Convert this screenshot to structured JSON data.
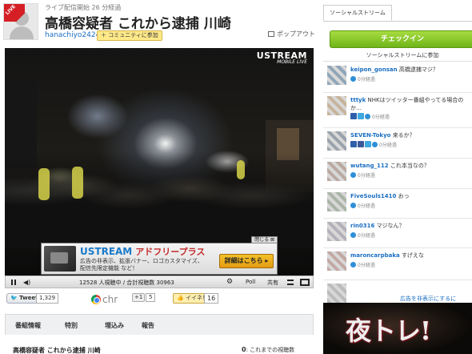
{
  "header": {
    "live_badge": "LIVE",
    "status_line": "ライブ配信開始 26 分経過",
    "title": "高橋容疑者 これから逮捕 川崎",
    "channel": "hanachiyo2424",
    "community_button": "＋ コミュニティに参加",
    "popout": "ポップアウト"
  },
  "player": {
    "logo_main": "USTREAM",
    "logo_sub": "MOBILE LIVE",
    "ad": {
      "close": "閉じる ⊠",
      "title": "USTREAM",
      "title_sub": "アドフリープラス",
      "text": "広告の非表示、拡張バナー、ロゴカスタマイズ、配信先限定機能 など！",
      "button": "詳細はこちら ▸"
    },
    "controls": {
      "volume_icon": "volume-icon",
      "viewers": "12528 人視聴中 / 合計視聴数 30963",
      "gear": "⚙",
      "poll": "Poll",
      "share": "共有"
    }
  },
  "share_row": {
    "tweet": "🐦 Tweet",
    "tweet_count": "1,329",
    "chrome_text": "chr",
    "gplus": "+1",
    "gplus_count": "5",
    "iine": "👍 イイネ！",
    "iine_count": "16"
  },
  "tabs": [
    "番組情報",
    "特別",
    "埋込み",
    "報告"
  ],
  "info": {
    "title": "高橋容疑者 これから逮捕 川崎",
    "views_count": "0",
    "views_label": ": これまでの視聴数"
  },
  "sidebar": {
    "tab_label": "ソーシャルストリーム",
    "checkin": "チェックイン",
    "join": "ソーシャルストリームに参加",
    "posts": [
      {
        "user": "keipon_gonsan",
        "text": "高橋逮捕マジ？",
        "time": "0分経過",
        "services": [],
        "color": "#8fa6b8"
      },
      {
        "user": "tttyk",
        "text": "NHKはツイッター番組やってる場合のか…",
        "time": "0分経過",
        "services": [
          "ustream",
          "twitter"
        ],
        "color": "#c6b39a"
      },
      {
        "user": "SEVEN-Tokyo",
        "text": "来るか？",
        "time": "0分経過",
        "services": [
          "ustream",
          "facebook",
          "twitter"
        ],
        "color": "#9aa3ac"
      },
      {
        "user": "wutang_112",
        "text": "これ本当なの？",
        "time": "0分経過",
        "services": [],
        "color": "#b9a9a0"
      },
      {
        "user": "FiveSouls1410",
        "text": "おっ",
        "time": "0分経過",
        "services": [],
        "color": "#a9b4a6"
      },
      {
        "user": "rin0316",
        "text": "マジなん？",
        "time": "0分経過",
        "services": [],
        "color": "#b4b0b8"
      },
      {
        "user": "maroncarpbaka",
        "text": "すげえな",
        "time": "0分経過",
        "services": [],
        "color": "#c2a8a4"
      },
      {
        "user": "",
        "text": "",
        "time": "",
        "services": [],
        "color": "#bbbbbb"
      }
    ],
    "hide_ads": "広告を非表示にするに",
    "ad_text": "夜トレ!"
  },
  "colors": {
    "accent_green": "#6fb51a",
    "link_blue": "#1a6ec2",
    "live_red": "#d51f25"
  }
}
